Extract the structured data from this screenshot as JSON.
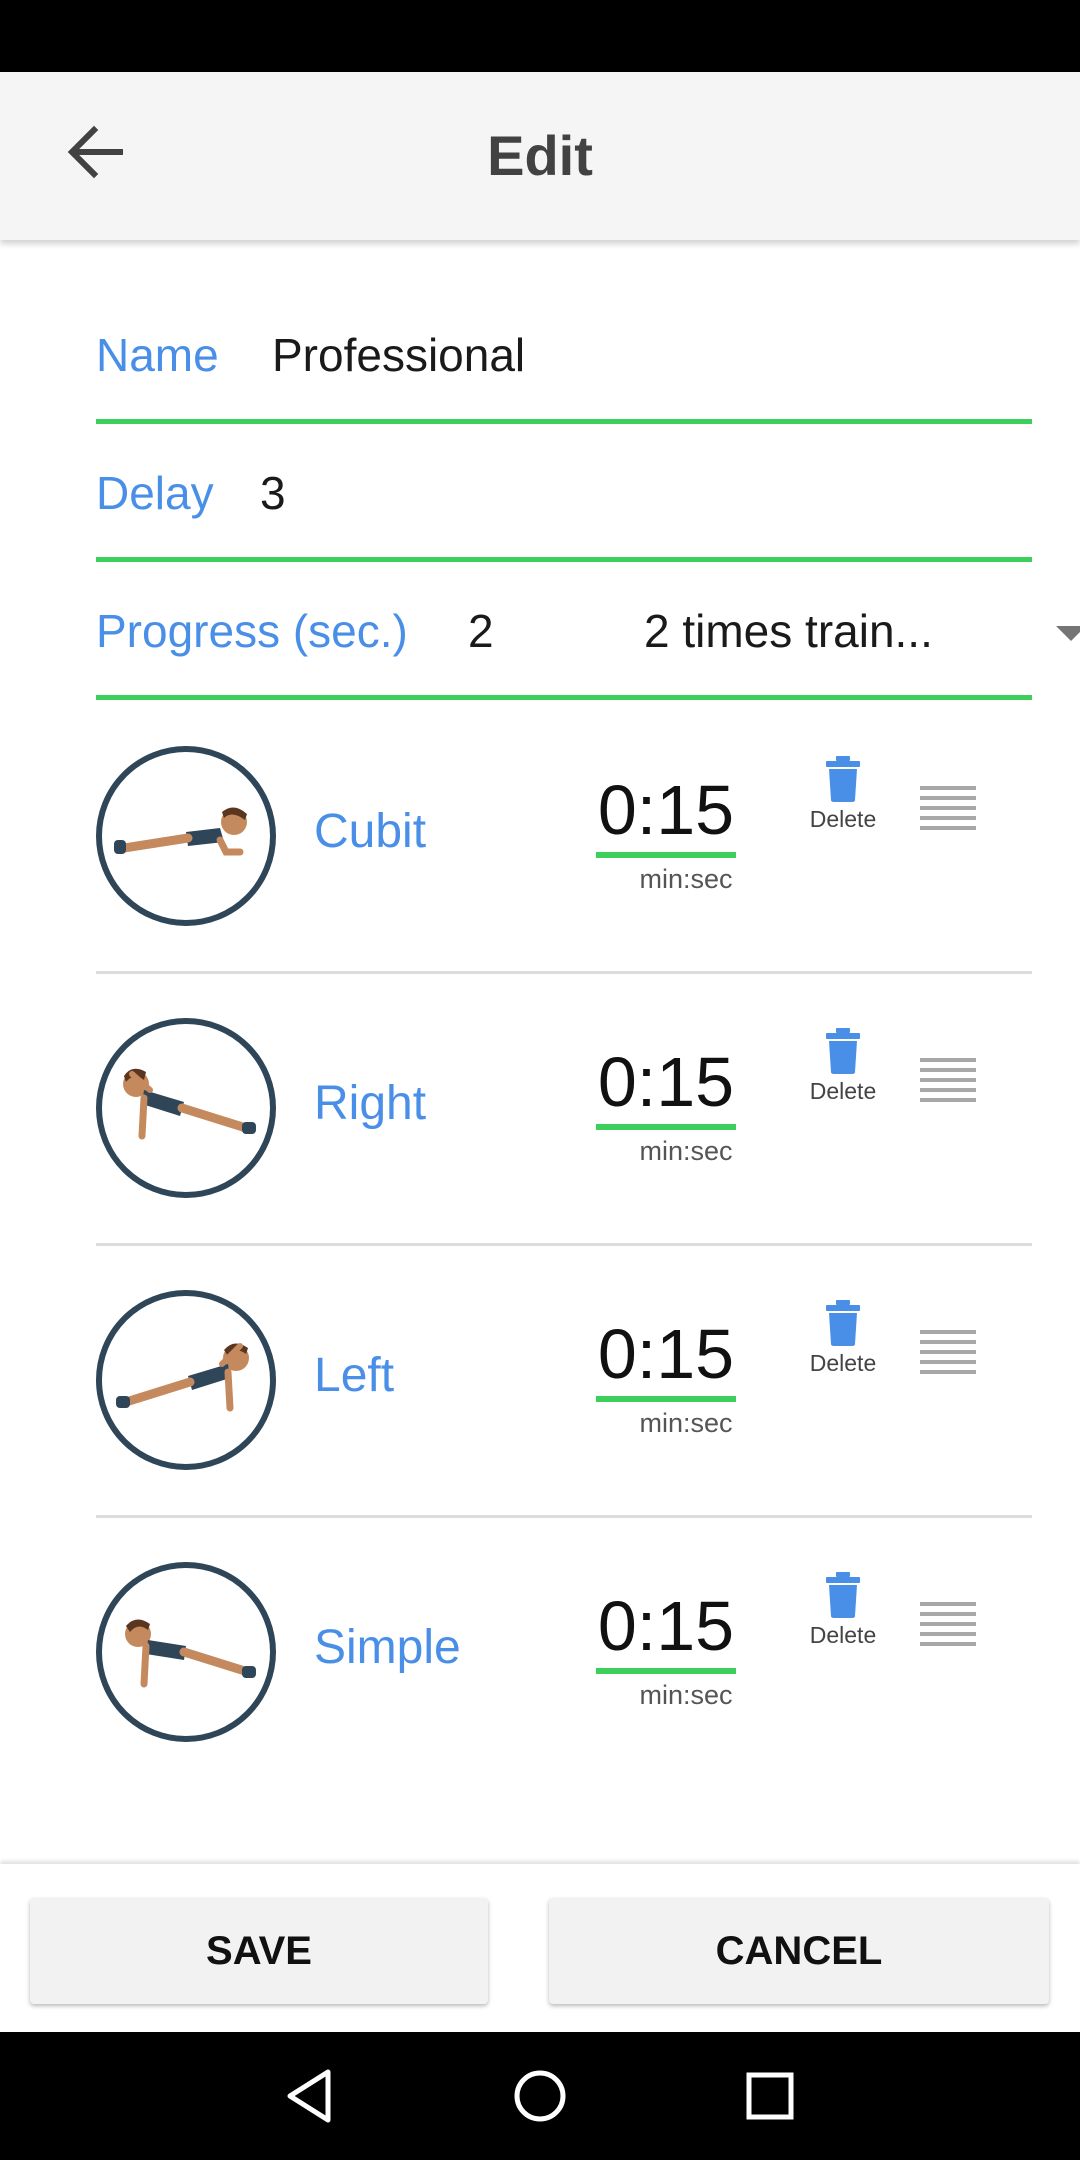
{
  "app_bar": {
    "title": "Edit"
  },
  "form": {
    "name": {
      "label": "Name",
      "value": "Professional"
    },
    "delay": {
      "label": "Delay",
      "value": "3"
    },
    "progress": {
      "label": "Progress (sec.)",
      "value": "2",
      "dropdown_value": "2 times train..."
    }
  },
  "exercises": [
    {
      "name": "Cubit",
      "time": "0:15",
      "unit": "min:sec",
      "delete_label": "Delete",
      "pose_icon": "forearm-plank-icon"
    },
    {
      "name": "Right",
      "time": "0:15",
      "unit": "min:sec",
      "delete_label": "Delete",
      "pose_icon": "right-side-plank-icon"
    },
    {
      "name": "Left",
      "time": "0:15",
      "unit": "min:sec",
      "delete_label": "Delete",
      "pose_icon": "left-side-plank-icon"
    },
    {
      "name": "Simple",
      "time": "0:15",
      "unit": "min:sec",
      "delete_label": "Delete",
      "pose_icon": "straight-arm-plank-icon"
    }
  ],
  "actions": {
    "save_label": "SAVE",
    "cancel_label": "CANCEL"
  },
  "colors": {
    "accent": "#4a8fe7",
    "underline": "#3ccf5c",
    "avatar_border": "#2f4558"
  }
}
